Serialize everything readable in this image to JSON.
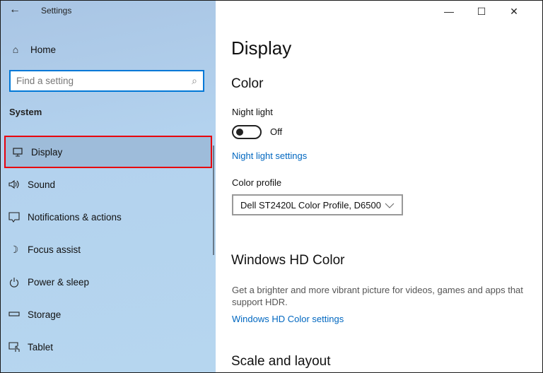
{
  "window": {
    "title": "Settings",
    "controls": {
      "minimize": "—",
      "maximize": "☐",
      "close": "✕"
    }
  },
  "sidebar": {
    "back_icon": "←",
    "home": {
      "label": "Home",
      "icon": "⌂"
    },
    "search": {
      "placeholder": "Find a setting",
      "icon": "⌕"
    },
    "section": "System",
    "items": [
      {
        "label": "Display",
        "icon": "▭",
        "selected": true
      },
      {
        "label": "Sound",
        "icon": "🔉︎"
      },
      {
        "label": "Notifications & actions",
        "icon": "▭"
      },
      {
        "label": "Focus assist",
        "icon": "☽"
      },
      {
        "label": "Power & sleep",
        "icon": "⏻"
      },
      {
        "label": "Storage",
        "icon": "▬"
      },
      {
        "label": "Tablet",
        "icon": "☝"
      }
    ]
  },
  "main": {
    "title": "Display",
    "color": {
      "heading": "Color",
      "night_light_label": "Night light",
      "night_light_state": "Off",
      "night_light_on": false,
      "night_light_link": "Night light settings",
      "profile_label": "Color profile",
      "profile_value": "Dell ST2420L Color Profile, D6500",
      "chevron": "⌄"
    },
    "hd": {
      "heading": "Windows HD Color",
      "description": "Get a brighter and more vibrant picture for videos, games and apps that support HDR.",
      "link": "Windows HD Color settings"
    },
    "scale": {
      "heading": "Scale and layout"
    }
  }
}
